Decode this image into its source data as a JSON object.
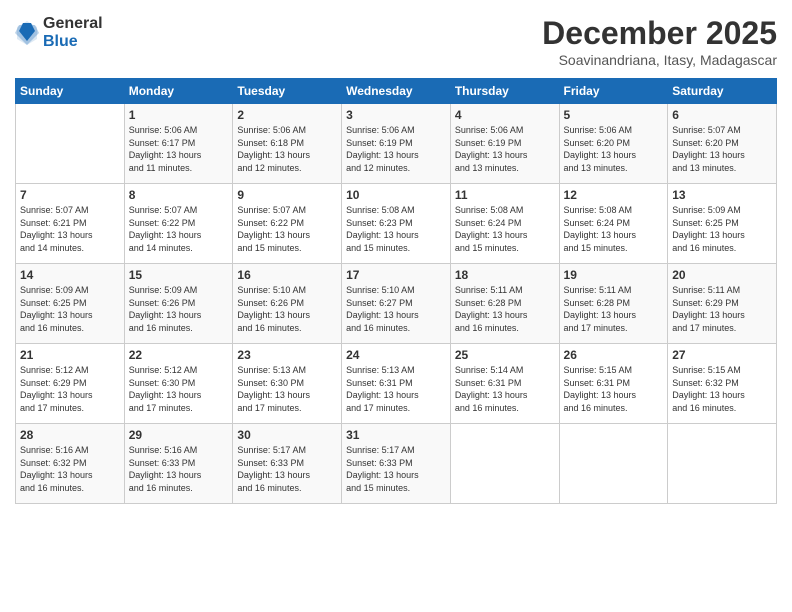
{
  "logo": {
    "general": "General",
    "blue": "Blue"
  },
  "header": {
    "month_year": "December 2025",
    "location": "Soavinandriana, Itasy, Madagascar"
  },
  "days_of_week": [
    "Sunday",
    "Monday",
    "Tuesday",
    "Wednesday",
    "Thursday",
    "Friday",
    "Saturday"
  ],
  "weeks": [
    [
      {
        "day": "",
        "info": ""
      },
      {
        "day": "1",
        "info": "Sunrise: 5:06 AM\nSunset: 6:17 PM\nDaylight: 13 hours\nand 11 minutes."
      },
      {
        "day": "2",
        "info": "Sunrise: 5:06 AM\nSunset: 6:18 PM\nDaylight: 13 hours\nand 12 minutes."
      },
      {
        "day": "3",
        "info": "Sunrise: 5:06 AM\nSunset: 6:19 PM\nDaylight: 13 hours\nand 12 minutes."
      },
      {
        "day": "4",
        "info": "Sunrise: 5:06 AM\nSunset: 6:19 PM\nDaylight: 13 hours\nand 13 minutes."
      },
      {
        "day": "5",
        "info": "Sunrise: 5:06 AM\nSunset: 6:20 PM\nDaylight: 13 hours\nand 13 minutes."
      },
      {
        "day": "6",
        "info": "Sunrise: 5:07 AM\nSunset: 6:20 PM\nDaylight: 13 hours\nand 13 minutes."
      }
    ],
    [
      {
        "day": "7",
        "info": "Sunrise: 5:07 AM\nSunset: 6:21 PM\nDaylight: 13 hours\nand 14 minutes."
      },
      {
        "day": "8",
        "info": "Sunrise: 5:07 AM\nSunset: 6:22 PM\nDaylight: 13 hours\nand 14 minutes."
      },
      {
        "day": "9",
        "info": "Sunrise: 5:07 AM\nSunset: 6:22 PM\nDaylight: 13 hours\nand 15 minutes."
      },
      {
        "day": "10",
        "info": "Sunrise: 5:08 AM\nSunset: 6:23 PM\nDaylight: 13 hours\nand 15 minutes."
      },
      {
        "day": "11",
        "info": "Sunrise: 5:08 AM\nSunset: 6:24 PM\nDaylight: 13 hours\nand 15 minutes."
      },
      {
        "day": "12",
        "info": "Sunrise: 5:08 AM\nSunset: 6:24 PM\nDaylight: 13 hours\nand 15 minutes."
      },
      {
        "day": "13",
        "info": "Sunrise: 5:09 AM\nSunset: 6:25 PM\nDaylight: 13 hours\nand 16 minutes."
      }
    ],
    [
      {
        "day": "14",
        "info": "Sunrise: 5:09 AM\nSunset: 6:25 PM\nDaylight: 13 hours\nand 16 minutes."
      },
      {
        "day": "15",
        "info": "Sunrise: 5:09 AM\nSunset: 6:26 PM\nDaylight: 13 hours\nand 16 minutes."
      },
      {
        "day": "16",
        "info": "Sunrise: 5:10 AM\nSunset: 6:26 PM\nDaylight: 13 hours\nand 16 minutes."
      },
      {
        "day": "17",
        "info": "Sunrise: 5:10 AM\nSunset: 6:27 PM\nDaylight: 13 hours\nand 16 minutes."
      },
      {
        "day": "18",
        "info": "Sunrise: 5:11 AM\nSunset: 6:28 PM\nDaylight: 13 hours\nand 16 minutes."
      },
      {
        "day": "19",
        "info": "Sunrise: 5:11 AM\nSunset: 6:28 PM\nDaylight: 13 hours\nand 17 minutes."
      },
      {
        "day": "20",
        "info": "Sunrise: 5:11 AM\nSunset: 6:29 PM\nDaylight: 13 hours\nand 17 minutes."
      }
    ],
    [
      {
        "day": "21",
        "info": "Sunrise: 5:12 AM\nSunset: 6:29 PM\nDaylight: 13 hours\nand 17 minutes."
      },
      {
        "day": "22",
        "info": "Sunrise: 5:12 AM\nSunset: 6:30 PM\nDaylight: 13 hours\nand 17 minutes."
      },
      {
        "day": "23",
        "info": "Sunrise: 5:13 AM\nSunset: 6:30 PM\nDaylight: 13 hours\nand 17 minutes."
      },
      {
        "day": "24",
        "info": "Sunrise: 5:13 AM\nSunset: 6:31 PM\nDaylight: 13 hours\nand 17 minutes."
      },
      {
        "day": "25",
        "info": "Sunrise: 5:14 AM\nSunset: 6:31 PM\nDaylight: 13 hours\nand 16 minutes."
      },
      {
        "day": "26",
        "info": "Sunrise: 5:15 AM\nSunset: 6:31 PM\nDaylight: 13 hours\nand 16 minutes."
      },
      {
        "day": "27",
        "info": "Sunrise: 5:15 AM\nSunset: 6:32 PM\nDaylight: 13 hours\nand 16 minutes."
      }
    ],
    [
      {
        "day": "28",
        "info": "Sunrise: 5:16 AM\nSunset: 6:32 PM\nDaylight: 13 hours\nand 16 minutes."
      },
      {
        "day": "29",
        "info": "Sunrise: 5:16 AM\nSunset: 6:33 PM\nDaylight: 13 hours\nand 16 minutes."
      },
      {
        "day": "30",
        "info": "Sunrise: 5:17 AM\nSunset: 6:33 PM\nDaylight: 13 hours\nand 16 minutes."
      },
      {
        "day": "31",
        "info": "Sunrise: 5:17 AM\nSunset: 6:33 PM\nDaylight: 13 hours\nand 15 minutes."
      },
      {
        "day": "",
        "info": ""
      },
      {
        "day": "",
        "info": ""
      },
      {
        "day": "",
        "info": ""
      }
    ]
  ]
}
